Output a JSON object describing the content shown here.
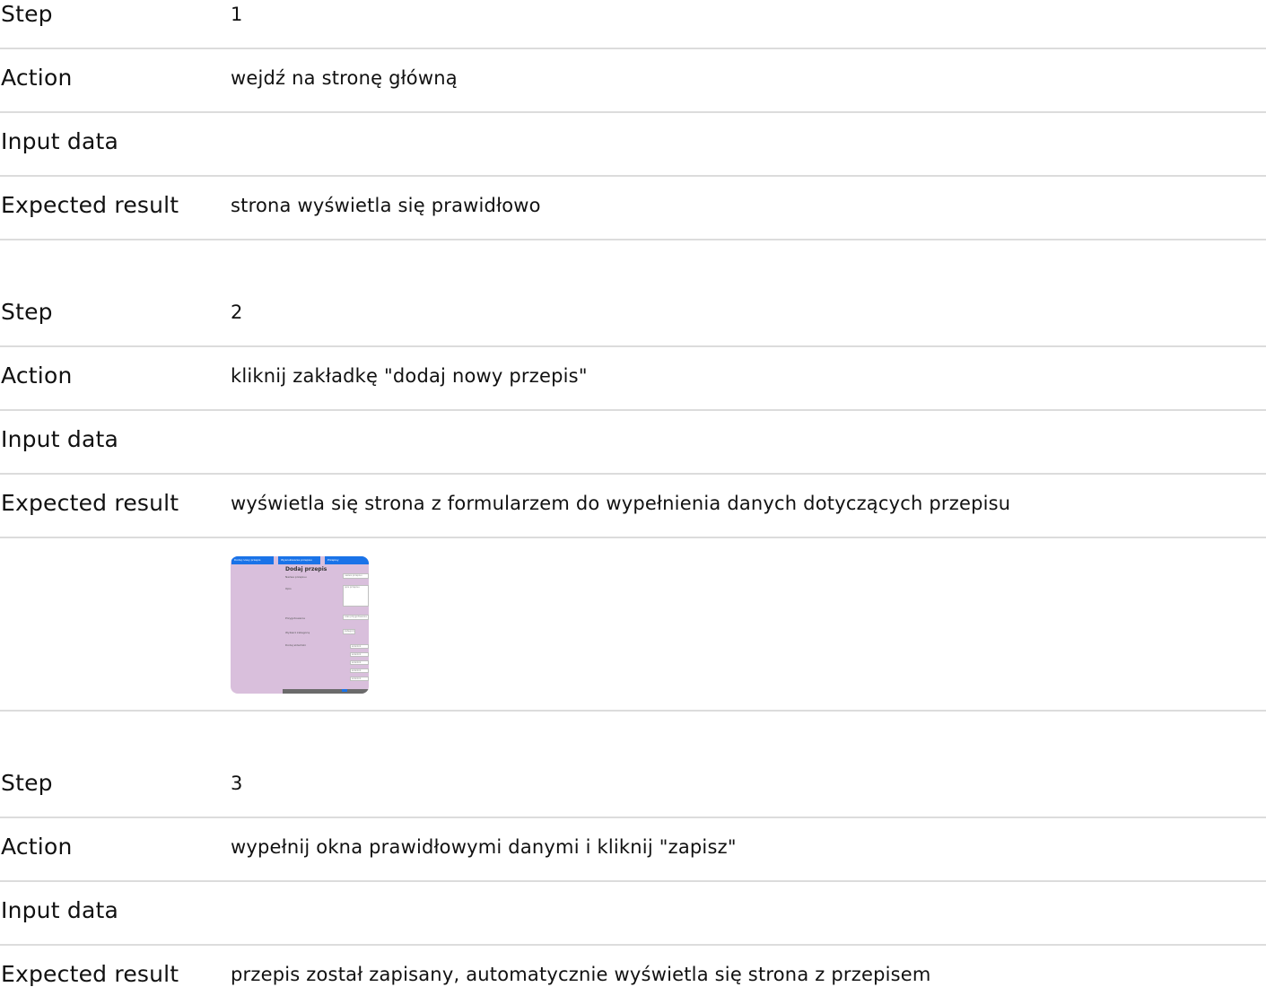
{
  "labels": {
    "step": "Step",
    "action": "Action",
    "input": "Input data",
    "expected": "Expected result"
  },
  "steps": [
    {
      "step": "1",
      "action": "wejdź na stronę główną",
      "input": "",
      "expected": "strona wyświetla się prawidłowo"
    },
    {
      "step": "2",
      "action": "kliknij zakładkę \"dodaj nowy przepis\"",
      "input": "",
      "expected": "wyświetla się strona z formularzem do wypełnienia danych dotyczących przepisu",
      "screenshot": {
        "tabs": [
          "Dodaj nowy przepis",
          "Wyszukiwanie przepisu",
          "Przepisy"
        ],
        "title": "Dodaj przepis",
        "fields": [
          {
            "label": "Nazwa przepisu",
            "placeholder": "nazwa przepisu"
          },
          {
            "label": "Opis",
            "placeholder": "opis przepisu"
          },
          {
            "label": "Przygotowanie",
            "placeholder": "czas przygotowania"
          },
          {
            "label": "Wybierz kategorię",
            "placeholder": "kategoria"
          },
          {
            "label": "Dodaj składniki",
            "placeholder": "składnik"
          }
        ],
        "colors": {
          "background": "#d9bfdc",
          "tab": "#1a73e8",
          "footer": "#6b6b6b"
        }
      }
    },
    {
      "step": "3",
      "action": "wypełnij okna prawidłowymi danymi i kliknij \"zapisz\"",
      "input": "",
      "expected": "przepis został zapisany, automatycznie wyświetla się strona z przepisem"
    }
  ]
}
